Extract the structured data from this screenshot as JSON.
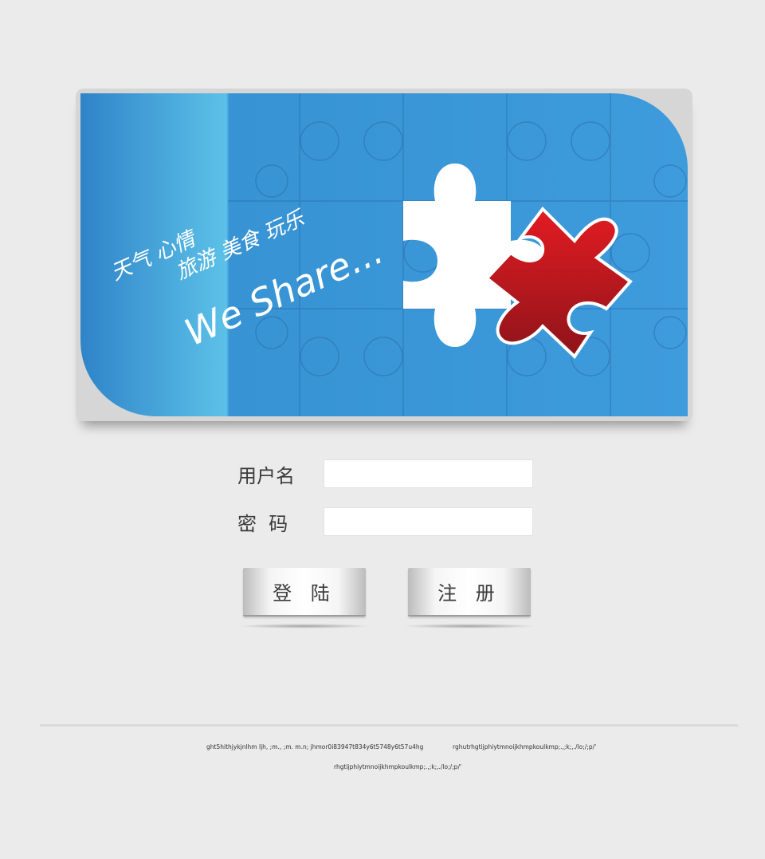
{
  "banner": {
    "tagline_line1": "天气 心情",
    "tagline_line2": "旅游 美食 玩乐",
    "slogan": "We Share...",
    "colors": {
      "blue_dark": "#2f84c8",
      "blue_light": "#5cc1e8",
      "puzzle_red": "#c81d25",
      "puzzle_white": "#ffffff"
    }
  },
  "form": {
    "username_label": "用户名",
    "username_value": "",
    "password_label": "密  码",
    "password_value": ""
  },
  "buttons": {
    "login_label": "登 陆",
    "register_label": "注 册"
  },
  "footer": {
    "line1_left": "ght5hithjykjnlhm ljh, ;m., ;m. m.n; jhmor0i83947t834y6t5748y6t57u4hg",
    "line1_right": "rghutrhgtijphiytmnoijkhmpkoulkmp;.,;k;,./lo;/;p/'",
    "line2": "rhgtijphiytmnoijkhmpkoulkmp;.,;k;,./lo;/;p/'"
  }
}
